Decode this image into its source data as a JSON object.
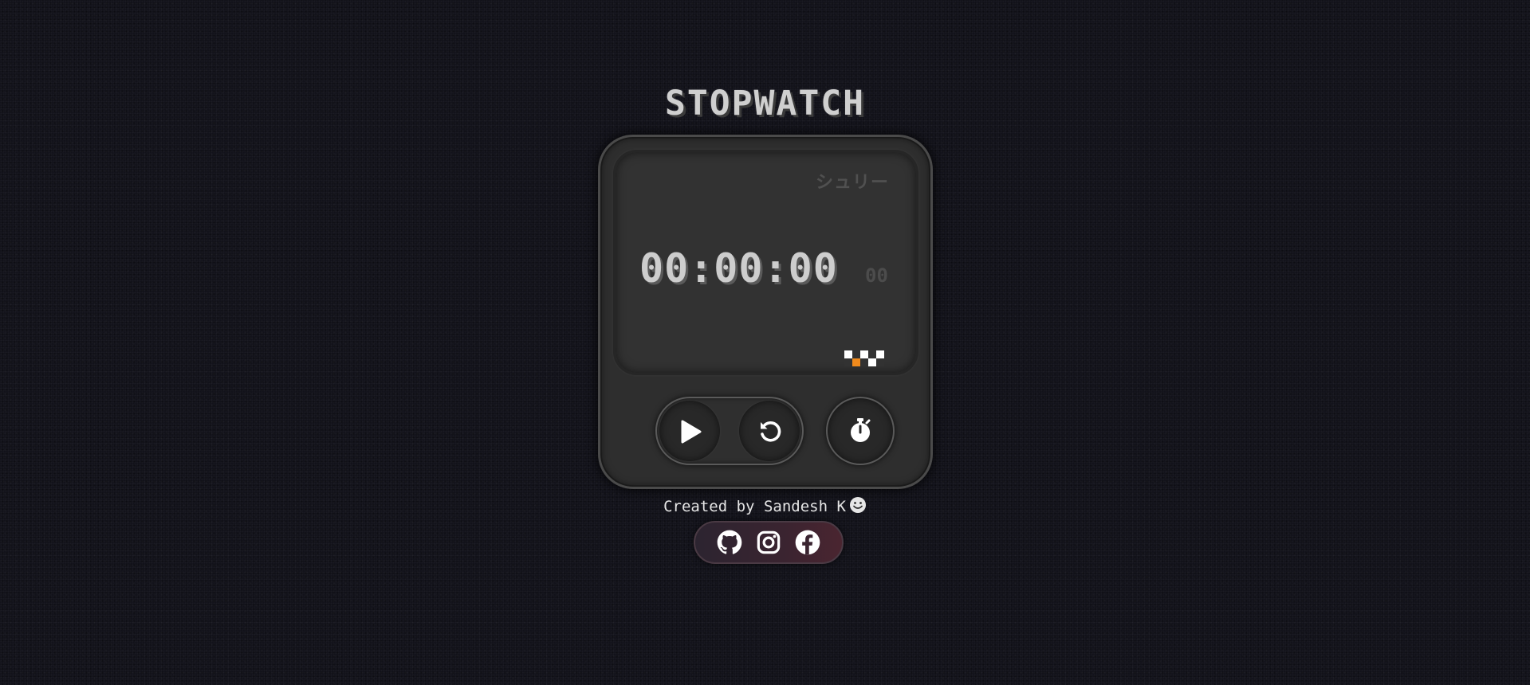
{
  "app": {
    "title": "STOPWATCH"
  },
  "screen": {
    "brand_label": "シュリー",
    "time": "00:00:00",
    "milliseconds": "00"
  },
  "controls": {
    "play_icon": "play-icon",
    "reset_icon": "reset-icon",
    "lap_icon": "stopwatch-icon"
  },
  "footer": {
    "credit": "Created by Sandesh K",
    "credit_icon": "smiley-icon",
    "social_icons": [
      "github-icon",
      "instagram-icon",
      "facebook-icon"
    ]
  },
  "colors": {
    "background": "#111119",
    "device": "#2e2e2e",
    "screen": "#323232",
    "digits": "#cdcdcd",
    "accent": "#f08a1c",
    "social_bar": "#3a2430"
  }
}
